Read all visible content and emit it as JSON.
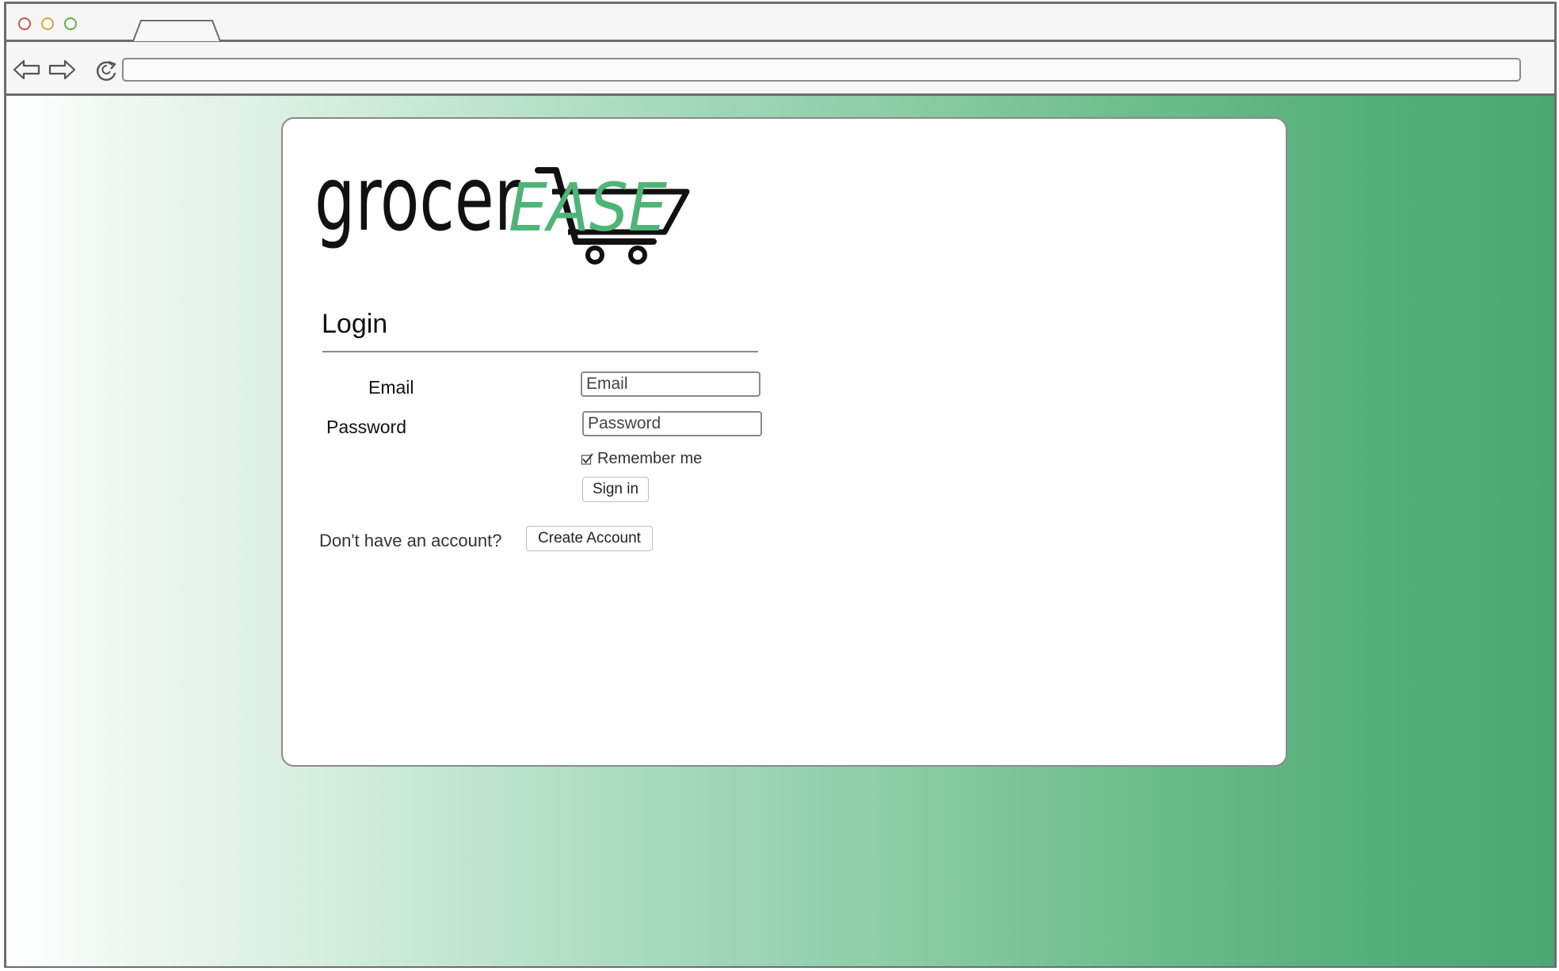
{
  "browser": {
    "address_url": "",
    "controls": {
      "back": "back-arrow-icon",
      "forward": "forward-arrow-icon",
      "reload": "reload-icon"
    }
  },
  "brand": {
    "logo_text_dark": "grocer",
    "logo_text_accent": "EASE",
    "accent_color": "#4fb576"
  },
  "login": {
    "heading": "Login",
    "email_label": "Email",
    "email_placeholder": "Email",
    "password_label": "Password",
    "password_placeholder": "Password",
    "remember_label": "Remember me",
    "remember_checked": true,
    "signin_label": "Sign in"
  },
  "signup": {
    "prompt": "Don't have an account?",
    "create_label": "Create Account"
  }
}
